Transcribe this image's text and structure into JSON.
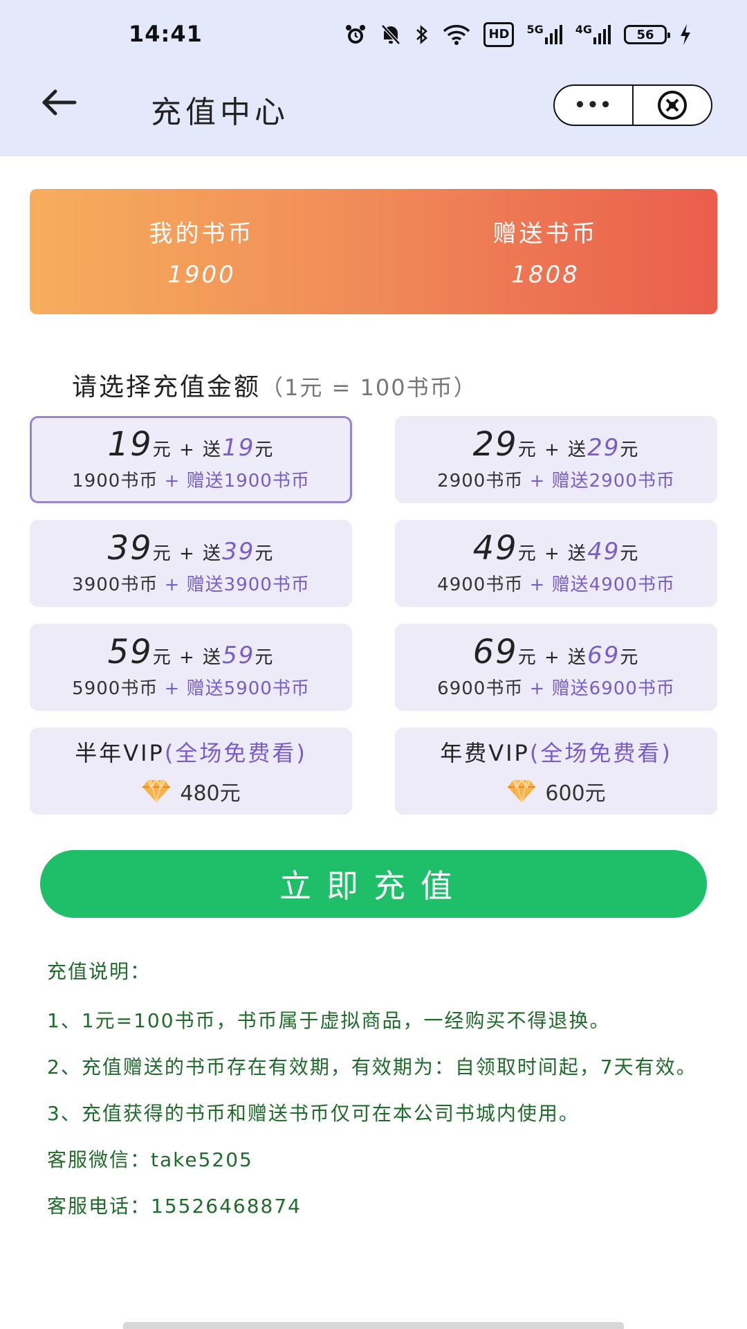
{
  "status_bar": {
    "time": "14:41",
    "hd": "HD",
    "net1": "5G",
    "net2": "4G",
    "battery": "56"
  },
  "nav": {
    "title": "充值中心",
    "more_label": "•••"
  },
  "balance": {
    "my_label": "我的书币",
    "my_value": "1900",
    "gift_label": "赠送书币",
    "gift_value": "1808"
  },
  "section": {
    "title": "请选择充值金额",
    "hint": "（1元 = 100书币）"
  },
  "options": [
    {
      "price": "19",
      "gift": "19",
      "coins": "1900书币",
      "bonus": "+ 赠送1900书币",
      "selected": true
    },
    {
      "price": "29",
      "gift": "29",
      "coins": "2900书币",
      "bonus": "+ 赠送2900书币",
      "selected": false
    },
    {
      "price": "39",
      "gift": "39",
      "coins": "3900书币",
      "bonus": "+ 赠送3900书币",
      "selected": false
    },
    {
      "price": "49",
      "gift": "49",
      "coins": "4900书币",
      "bonus": "+ 赠送4900书币",
      "selected": false
    },
    {
      "price": "59",
      "gift": "59",
      "coins": "5900书币",
      "bonus": "+ 赠送5900书币",
      "selected": false
    },
    {
      "price": "69",
      "gift": "69",
      "coins": "6900书币",
      "bonus": "+ 赠送6900书币",
      "selected": false
    }
  ],
  "option_labels": {
    "yuan": "元",
    "plus_gift": " + 送"
  },
  "vip": [
    {
      "name": "半年VIP",
      "desc": "(全场免费看)",
      "price": "480元"
    },
    {
      "name": "年费VIP",
      "desc": "(全场免费看)",
      "price": "600元"
    }
  ],
  "recharge_button": "立即充值",
  "notes": {
    "title": "充值说明：",
    "items": [
      "1、1元=100书币，书币属于虚拟商品，一经购买不得退换。",
      "2、充值赠送的书币存在有效期，有效期为：自领取时间起，7天有效。",
      "3、充值获得的书币和赠送书币仅可在本公司书城内使用。"
    ],
    "wechat": "客服微信：take5205",
    "phone": "客服电话：15526468874"
  },
  "colors": {
    "header_bg": "#e4e8fb",
    "accent_purple": "#7a5cc8",
    "button_green": "#1fbf69",
    "note_green": "#1f6b2a"
  }
}
